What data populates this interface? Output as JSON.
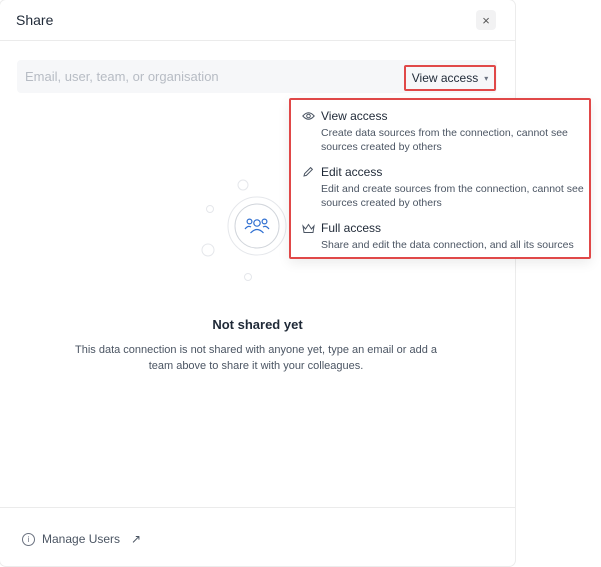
{
  "modal": {
    "title": "Share",
    "close_label": "×"
  },
  "search": {
    "placeholder": "Email, user, team, or organisation",
    "value": ""
  },
  "access_select": {
    "selected": "View access"
  },
  "dropdown": {
    "options": [
      {
        "label": "View access",
        "description": "Create data sources from the connection, cannot see sources created by others",
        "icon": "eye-icon"
      },
      {
        "label": "Edit access",
        "description": "Edit and create sources from the connection, cannot see sources created by others",
        "icon": "pencil-icon"
      },
      {
        "label": "Full access",
        "description": "Share and edit the data connection, and all its sources",
        "icon": "crown-icon"
      }
    ]
  },
  "empty_state": {
    "title": "Not shared yet",
    "description": "This data connection is not shared with anyone yet, type an email or add a team above to share it with your colleagues."
  },
  "footer": {
    "manage_users_label": "Manage Users"
  },
  "colors": {
    "highlight": "#e04848",
    "accent": "#2f6fd1"
  }
}
